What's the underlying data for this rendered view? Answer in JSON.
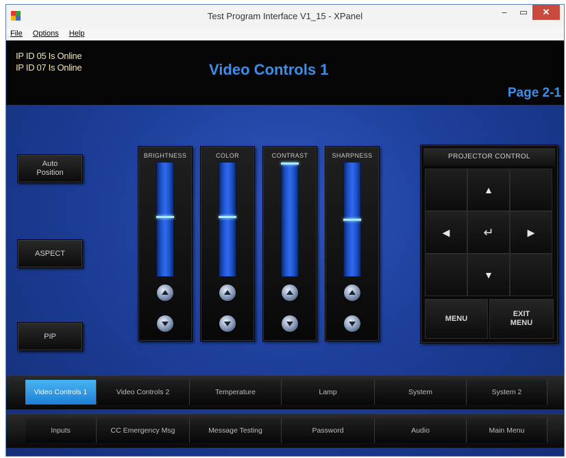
{
  "window": {
    "title": "Test Program Interface V1_15 - XPanel",
    "minimize": "–",
    "maximize": "▭",
    "close": "✕"
  },
  "menu": [
    "File",
    "Options",
    "Help"
  ],
  "header": {
    "status_lines": [
      "IP ID 05 Is Online",
      "IP ID 07 Is Online"
    ],
    "page_title": "Video Controls 1",
    "page_number": "Page 2-1"
  },
  "left_buttons": [
    "Auto\nPosition",
    "ASPECT",
    "PIP"
  ],
  "sliders": [
    {
      "label": "BRIGHTNESS",
      "level": 0.52
    },
    {
      "label": "COLOR",
      "level": 0.52
    },
    {
      "label": "CONTRAST",
      "level": 1.0
    },
    {
      "label": "SHARPNESS",
      "level": 0.5
    }
  ],
  "projector": {
    "title": "PROJECTOR CONTROL",
    "menu_label": "MENU",
    "exit_label": "EXIT\nMENU",
    "up_icon": "▲",
    "down_icon": "▼",
    "left_icon": "◀",
    "right_icon": "▶",
    "enter_icon": "↵"
  },
  "tabs_row1": [
    "Video Controls 1",
    "Video Controls 2",
    "Temperature",
    "Lamp",
    "System",
    "System 2"
  ],
  "tabs_row2": [
    "Inputs",
    "CC Emergency Msg",
    "Message Testing",
    "Password",
    "Audio",
    "Main Menu"
  ],
  "active_tab": "Video Controls 1",
  "colors": {
    "accent": "#3b8fe8",
    "status_text": "#f0e6b0",
    "active_tab": "#2a93e4",
    "slider_thumb": "#9ff3ff"
  }
}
